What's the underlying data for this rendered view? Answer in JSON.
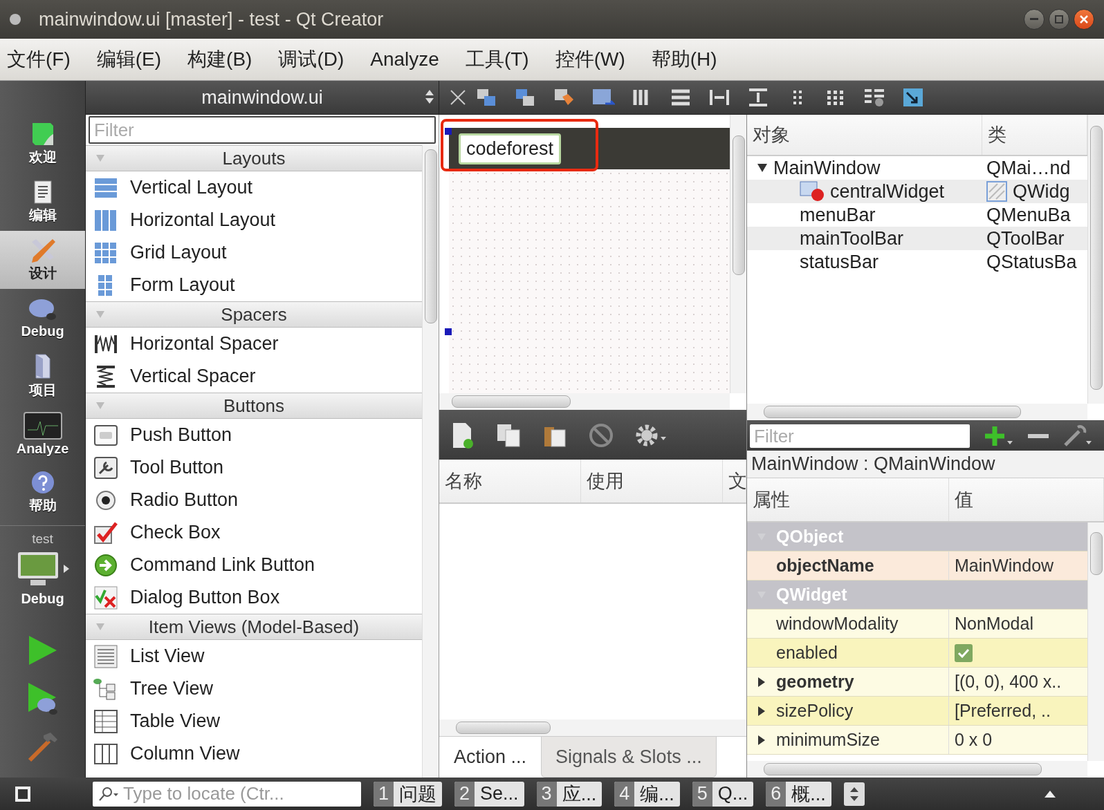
{
  "window": {
    "title": "mainwindow.ui [master] - test - Qt Creator"
  },
  "menu": [
    "文件(F)",
    "编辑(E)",
    "构建(B)",
    "调试(D)",
    "Analyze",
    "工具(T)",
    "控件(W)",
    "帮助(H)"
  ],
  "modes": [
    {
      "label": "欢迎",
      "selected": false
    },
    {
      "label": "编辑",
      "selected": false
    },
    {
      "label": "设计",
      "selected": true
    },
    {
      "label": "Debug",
      "selected": false
    },
    {
      "label": "项目",
      "selected": false
    },
    {
      "label": "Analyze",
      "selected": false
    },
    {
      "label": "帮助",
      "selected": false
    }
  ],
  "run_target": {
    "project": "test",
    "config": "Debug"
  },
  "editor_toolbar": {
    "file": "mainwindow.ui"
  },
  "widget_box": {
    "filter_placeholder": "Filter",
    "sections": [
      {
        "title": "Layouts",
        "expanded": true,
        "items": [
          "Vertical Layout",
          "Horizontal Layout",
          "Grid Layout",
          "Form Layout"
        ]
      },
      {
        "title": "Spacers",
        "expanded": true,
        "items": [
          "Horizontal Spacer",
          "Vertical Spacer"
        ]
      },
      {
        "title": "Buttons",
        "expanded": true,
        "items": [
          "Push Button",
          "Tool Button",
          "Radio Button",
          "Check Box",
          "Command Link Button",
          "Dialog Button Box"
        ]
      },
      {
        "title": "Item Views (Model-Based)",
        "expanded": true,
        "items": [
          "List View",
          "Tree View",
          "Table View",
          "Column View"
        ]
      }
    ]
  },
  "form": {
    "label_text": "codeforest"
  },
  "action_editor": {
    "columns": [
      "名称",
      "使用",
      "文"
    ],
    "tabs": [
      {
        "label": "Action ...",
        "selected": true
      },
      {
        "label": "Signals & Slots ...",
        "selected": false
      }
    ]
  },
  "object_inspector": {
    "columns": [
      "对象",
      "类"
    ],
    "rows": [
      {
        "object": "MainWindow",
        "class": "QMai…nd",
        "expanded": true,
        "children": [
          {
            "object": "centralWidget",
            "class": "QWidg"
          },
          {
            "object": "menuBar",
            "class": "QMenuBa"
          },
          {
            "object": "mainToolBar",
            "class": "QToolBar"
          },
          {
            "object": "statusBar",
            "class": "QStatusBa"
          }
        ]
      }
    ]
  },
  "property_editor": {
    "filter_placeholder": "Filter",
    "object_title": "MainWindow : QMainWindow",
    "columns": [
      "属性",
      "值"
    ],
    "rows": [
      {
        "kind": "group",
        "name": "QObject",
        "expanded": true
      },
      {
        "kind": "property",
        "name": "objectName",
        "value": "MainWindow",
        "changed": true,
        "color": "#fbeadb"
      },
      {
        "kind": "group",
        "name": "QWidget",
        "expanded": true
      },
      {
        "kind": "property",
        "name": "windowModality",
        "value": "NonModal",
        "changed": false,
        "color": "#fdfbe3"
      },
      {
        "kind": "checkbox",
        "name": "enabled",
        "checked": true,
        "changed": false,
        "color": "#f9f4bd"
      },
      {
        "kind": "property",
        "name": "geometry",
        "value": "[(0, 0), 400 x..",
        "changed": true,
        "expanded": false,
        "color": "#fdfbe3"
      },
      {
        "kind": "property",
        "name": "sizePolicy",
        "value": "[Preferred, ..",
        "changed": false,
        "expanded": false,
        "color": "#f9f4bd"
      },
      {
        "kind": "property",
        "name": "minimumSize",
        "value": "0 x 0",
        "changed": false,
        "expanded": false,
        "color": "#fdfbe3"
      }
    ]
  },
  "output_panes": {
    "locator_placeholder": "Type to locate (Ctr...",
    "panes": [
      {
        "number": "1",
        "label": "问题"
      },
      {
        "number": "2",
        "label": "Se..."
      },
      {
        "number": "3",
        "label": "应..."
      },
      {
        "number": "4",
        "label": "编..."
      },
      {
        "number": "5",
        "label": "Q..."
      },
      {
        "number": "6",
        "label": "概..."
      }
    ]
  }
}
